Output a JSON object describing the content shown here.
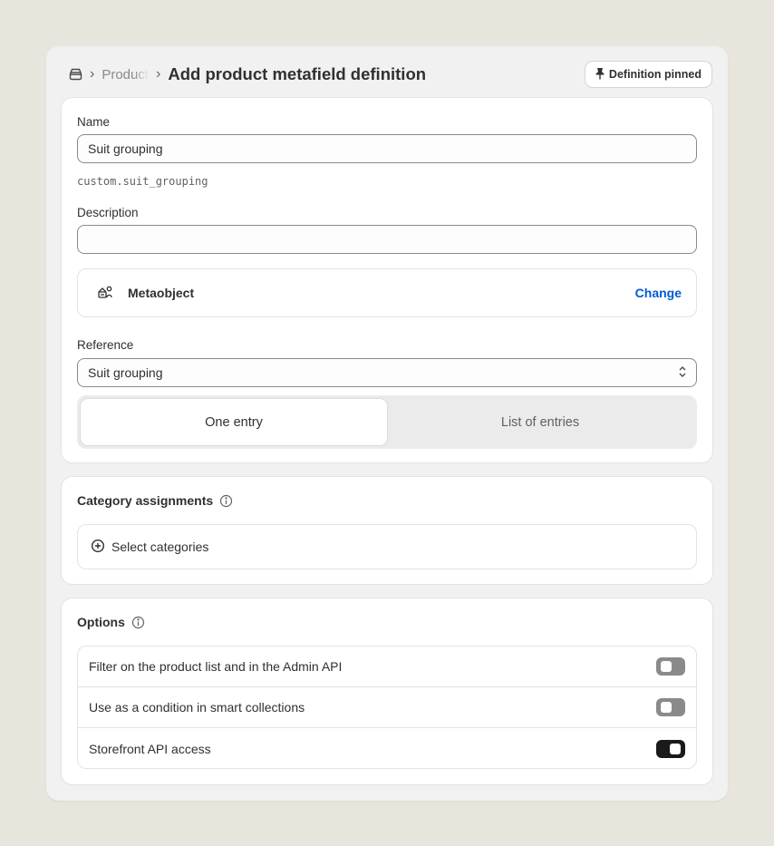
{
  "header": {
    "breadcrumb_parent": "Product",
    "title": "Add product metafield definition",
    "pin_button_label": "Definition pinned"
  },
  "definition": {
    "name_label": "Name",
    "name_value": "Suit grouping",
    "namespace_key": "custom.suit_grouping",
    "description_label": "Description",
    "description_value": "",
    "type_name": "Metaobject",
    "change_label": "Change",
    "reference_label": "Reference",
    "reference_value": "Suit grouping",
    "entry_options": [
      "One entry",
      "List of entries"
    ],
    "selected_entry_option": "One entry"
  },
  "categories": {
    "title": "Category assignments",
    "select_label": "Select categories"
  },
  "options": {
    "title": "Options",
    "items": [
      {
        "label": "Filter on the product list and in the Admin API",
        "enabled": false
      },
      {
        "label": "Use as a condition in smart collections",
        "enabled": false
      },
      {
        "label": "Storefront API access",
        "enabled": true
      }
    ]
  },
  "colors": {
    "background": "#e8e6dc",
    "link": "#005bd3",
    "toggle_on": "#1a1a1a",
    "toggle_off": "#8a8a8a"
  },
  "icons": {
    "home": "store-icon",
    "pin": "pin-icon",
    "type": "metaobject-icon",
    "select": "chevron-up-down-icon",
    "info": "info-icon",
    "add": "plus-circle-icon"
  }
}
